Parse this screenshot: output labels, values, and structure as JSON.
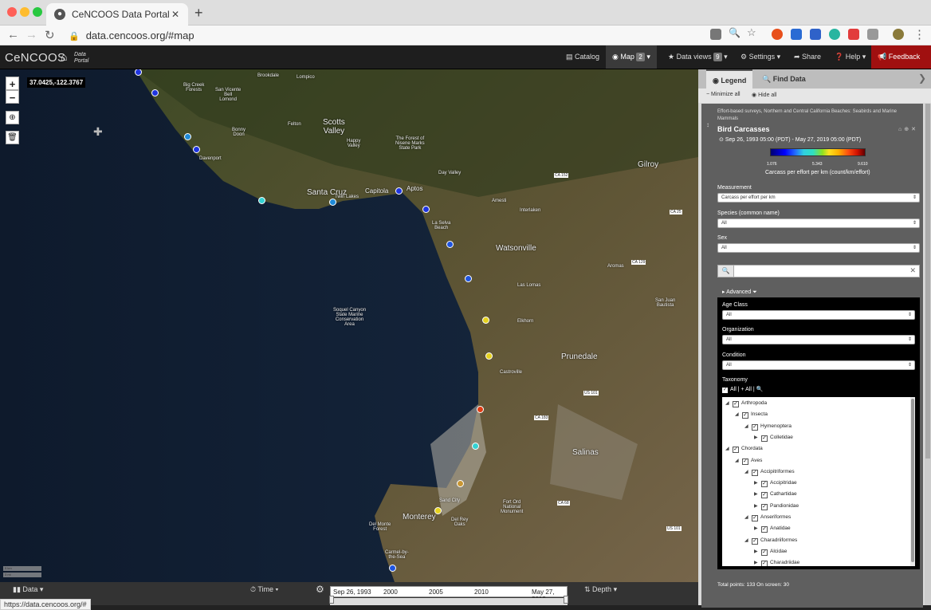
{
  "browser": {
    "tab_title": "CeNCOOS Data Portal: Map po",
    "url": "data.cencoos.org/#map",
    "status_url": "https://data.cencoos.org/#"
  },
  "app": {
    "brand": "CeNCOOS",
    "brand_sub_line1": "Data",
    "brand_sub_line2": "Portal",
    "nav": {
      "catalog": "Catalog",
      "map": "Map",
      "map_count": "2",
      "data_views": "Data views",
      "data_views_count": "9",
      "settings": "Settings",
      "share": "Share",
      "help": "Help",
      "feedback": "Feedback"
    }
  },
  "map": {
    "coords": "37.0425,-122.3767",
    "zoom_in": "+",
    "zoom_out": "−",
    "scale_km": "5 km",
    "scale_mi": "3 mi",
    "places": {
      "brookdale": "Brookdale",
      "lompico": "Lompico",
      "big_creek": "Big Creek\nForests",
      "san_vicente": "San Vicente\nBell\nLomond",
      "scotts_valley": "Scotts\nValley",
      "felton": "Felton",
      "bonny_doon": "Bonny\nDoon",
      "happy_valley": "Happy\nValley",
      "forest_nisene": "The Forest of\nNisene Marks\nState Park",
      "davenport": "Davenport",
      "santa_cruz": "Santa Cruz",
      "capitola": "Capitola",
      "aptos": "Aptos",
      "twin_lakes": "Twin Lakes",
      "day_valley": "Day Valley",
      "amesti": "Amesti",
      "interlaken": "Interlaken",
      "la_selva": "La Selva\nBeach",
      "watsonville": "Watsonville",
      "gilroy": "Gilroy",
      "aromas": "Aromas",
      "las_lomas": "Las Lomas",
      "san_juan": "San Juan\nBautista",
      "soquel_canyon": "Soquel Canyon\nState Marine\nConservation\nArea",
      "elkhorn": "Elkhorn",
      "prunedale": "Prunedale",
      "castroville": "Castroville",
      "salinas": "Salinas",
      "sand_city": "Sand City",
      "fort_ord": "Fort Ord\nNational\nMonument",
      "monterey": "Monterey",
      "del_monte": "Del Monte\nForest",
      "del_rey": "Del Rey\nOaks",
      "carmel": "Carmel-by-\nthe-Sea",
      "ca152": "CA 152",
      "ca25": "CA 25",
      "ca129": "CA 129",
      "ca183": "CA 183",
      "us101a": "US 101",
      "ca68": "CA 68",
      "us101b": "US 101"
    },
    "points_colors": {
      "blue": "#1f35e0",
      "cyan": "#35d2d2",
      "yellow": "#e6d21e",
      "red": "#e03c14",
      "orange": "#c89632"
    }
  },
  "bottombar": {
    "data": "Data",
    "time": "Time",
    "depth": "Depth",
    "timeline_start": "Sep 26, 1993",
    "tick_2000": "2000",
    "tick_2005": "2005",
    "tick_2010": "2010",
    "timeline_end": "May 27, 2019"
  },
  "panel": {
    "tab_legend": "Legend",
    "tab_find": "Find Data",
    "minimize_all": "Minimize all",
    "hide_all": "Hide all",
    "layer": {
      "source": "Effort-based surveys, Northern and Central California Beaches: Seabirds and Marine Mammals",
      "title": "Bird Carcasses",
      "date_range": "Sep 26, 1993 05:00 (PDT) - May 27, 2019 05:00 (PDT)",
      "cbar_min": "1.076",
      "cbar_mid": "5.343",
      "cbar_max": "9.610",
      "cbar_label": "Carcass per effort per km (count/km/effort)"
    },
    "filters": {
      "measurement_label": "Measurement",
      "measurement_value": "Carcass per effort per km",
      "species_label": "Species (common name)",
      "species_value": "All",
      "sex_label": "Sex",
      "sex_value": "All",
      "advanced": "Advanced",
      "age_label": "Age Class",
      "age_value": "All",
      "org_label": "Organization",
      "org_value": "All",
      "condition_label": "Condition",
      "condition_value": "All",
      "taxonomy_label": "Taxonomy",
      "taxonomy_controls": "All | + All |"
    },
    "tree": [
      {
        "label": "Arthropoda",
        "level": 0,
        "twisty": "◢"
      },
      {
        "label": "Insecta",
        "level": 1,
        "twisty": "◢"
      },
      {
        "label": "Hymenoptera",
        "level": 2,
        "twisty": "◢"
      },
      {
        "label": "Colletidae",
        "level": 3,
        "twisty": "▶"
      },
      {
        "label": "Chordata",
        "level": 0,
        "twisty": "◢"
      },
      {
        "label": "Aves",
        "level": 1,
        "twisty": "◢"
      },
      {
        "label": "Accipitriformes",
        "level": 2,
        "twisty": "◢"
      },
      {
        "label": "Accipitridae",
        "level": 3,
        "twisty": "▶"
      },
      {
        "label": "Cathartidae",
        "level": 3,
        "twisty": "▶"
      },
      {
        "label": "Pandionidae",
        "level": 3,
        "twisty": "▶"
      },
      {
        "label": "Anseriformes",
        "level": 2,
        "twisty": "◢"
      },
      {
        "label": "Anatidae",
        "level": 3,
        "twisty": "▶"
      },
      {
        "label": "Charadriiformes",
        "level": 2,
        "twisty": "◢"
      },
      {
        "label": "Alcidae",
        "level": 3,
        "twisty": "▶"
      },
      {
        "label": "Charadriidae",
        "level": 3,
        "twisty": "▶"
      }
    ],
    "total": "Total points: 133 On screen: 30"
  }
}
